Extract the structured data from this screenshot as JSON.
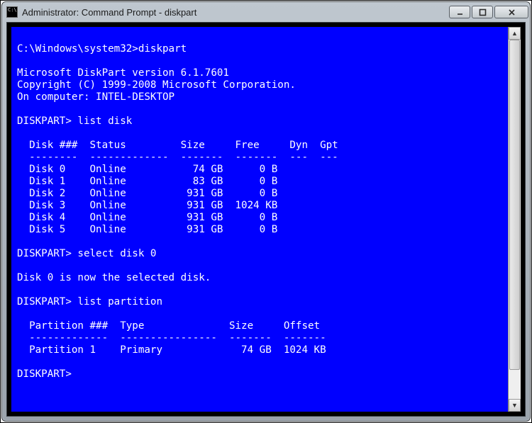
{
  "window": {
    "title": "Administrator: Command Prompt - diskpart"
  },
  "prompt": {
    "initial": "C:\\Windows\\system32>",
    "cmd_initial": "diskpart",
    "dp_prompt": "DISKPART>",
    "cmd_list_disk": "list disk",
    "cmd_select": "select disk 0",
    "cmd_list_part": "list partition",
    "select_response": "Disk 0 is now the selected disk."
  },
  "header": {
    "line1": "Microsoft DiskPart version 6.1.7601",
    "line2": "Copyright (C) 1999-2008 Microsoft Corporation.",
    "line3": "On computer: INTEL-DESKTOP"
  },
  "disk_table": {
    "head": "  Disk ###  Status         Size     Free     Dyn  Gpt",
    "rule": "  --------  -------------  -------  -------  ---  ---",
    "rows": [
      "  Disk 0    Online           74 GB      0 B",
      "  Disk 1    Online           83 GB      0 B",
      "  Disk 2    Online          931 GB      0 B",
      "  Disk 3    Online          931 GB  1024 KB",
      "  Disk 4    Online          931 GB      0 B",
      "  Disk 5    Online          931 GB      0 B"
    ]
  },
  "part_table": {
    "head": "  Partition ###  Type              Size     Offset",
    "rule": "  -------------  ----------------  -------  -------",
    "rows": [
      "  Partition 1    Primary             74 GB  1024 KB"
    ]
  }
}
